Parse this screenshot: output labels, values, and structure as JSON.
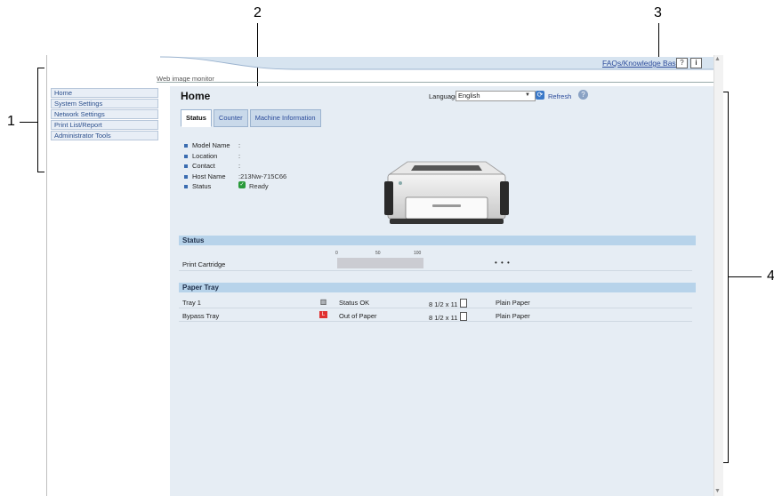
{
  "callouts": {
    "c1": "1",
    "c2": "2",
    "c3": "3",
    "c4": "4"
  },
  "header": {
    "faq_link": "FAQs/Knowledge Base",
    "help_icon": "?",
    "info_icon": "i",
    "app_title": "Web image monitor"
  },
  "sidebar": {
    "items": [
      {
        "label": "Home"
      },
      {
        "label": "System Settings"
      },
      {
        "label": "Network Settings"
      },
      {
        "label": "Print List/Report"
      },
      {
        "label": "Administrator Tools"
      }
    ]
  },
  "main": {
    "title": "Home",
    "language_label": "Language",
    "language_value": "English",
    "refresh_label": "Refresh",
    "tabs": [
      {
        "label": "Status"
      },
      {
        "label": "Counter"
      },
      {
        "label": "Machine Information"
      }
    ],
    "device_info": [
      {
        "label": "Model Name",
        "value": ":"
      },
      {
        "label": "Location",
        "value": ":"
      },
      {
        "label": "Contact",
        "value": ":"
      },
      {
        "label": "Host Name",
        "value": ":213Nw-715C66"
      },
      {
        "label": "Status",
        "value": "Ready"
      }
    ],
    "status_section": {
      "heading": "Status",
      "scale": [
        "0",
        "50",
        "100"
      ],
      "cartridge_label": "Print Cartridge",
      "cartridge_level": "• • •"
    },
    "paper_tray_section": {
      "heading": "Paper Tray",
      "rows": [
        {
          "tray": "Tray 1",
          "status": "Status OK",
          "size": "8 1/2 x 11",
          "type": "Plain Paper"
        },
        {
          "tray": "Bypass Tray",
          "status": "Out of Paper",
          "size": "8 1/2 x 11",
          "type": "Plain Paper"
        }
      ]
    }
  },
  "colors": {
    "accent": "#2a4a9a",
    "content_bg": "#e6edf4",
    "section_header": "#b7d3ea",
    "error": "#e03030",
    "ok": "#2a9a3a"
  },
  "icons": [
    "help-icon",
    "info-icon",
    "refresh-icon",
    "question-icon",
    "ready-icon",
    "tray-ok-icon",
    "tray-error-icon",
    "paper-size-icon",
    "printer-image"
  ]
}
